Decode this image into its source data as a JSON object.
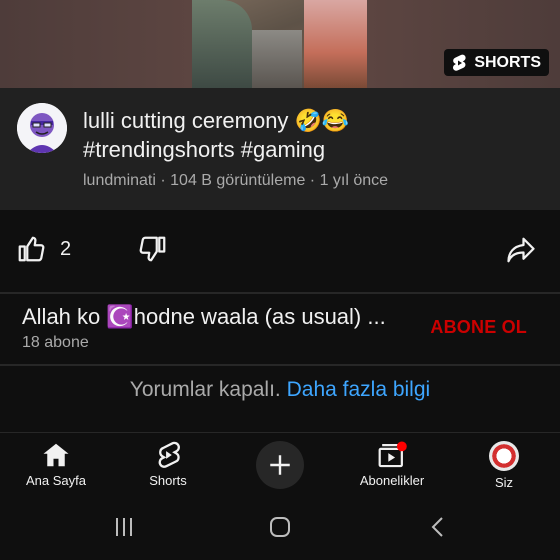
{
  "video": {
    "badge_label": "SHORTS",
    "title_line1": "lulli cutting ceremony 🤣😂",
    "title_line2": "#trendingshorts #gaming",
    "meta": "lundminati · 104 B görüntüleme · 1 yıl önce"
  },
  "actions": {
    "like_count": "2"
  },
  "channel": {
    "name": "Allah ko ☪️hodne waala (as usual) ...",
    "subscribers": "18 abone",
    "subscribe_label": "ABONE OL"
  },
  "comments": {
    "text": "Yorumlar kapalı.",
    "link": "Daha fazla bilgi"
  },
  "nav": {
    "items": [
      {
        "label": "Ana Sayfa",
        "icon": "home-icon"
      },
      {
        "label": "Shorts",
        "icon": "shorts-icon"
      },
      {
        "label": "",
        "icon": "plus-icon"
      },
      {
        "label": "Abonelikler",
        "icon": "subscriptions-icon"
      },
      {
        "label": "Siz",
        "icon": "avatar"
      }
    ]
  },
  "colors": {
    "background": "#0f0f0f",
    "panel": "#212121",
    "subscribe": "#cc0000",
    "link": "#3ea6ff"
  }
}
